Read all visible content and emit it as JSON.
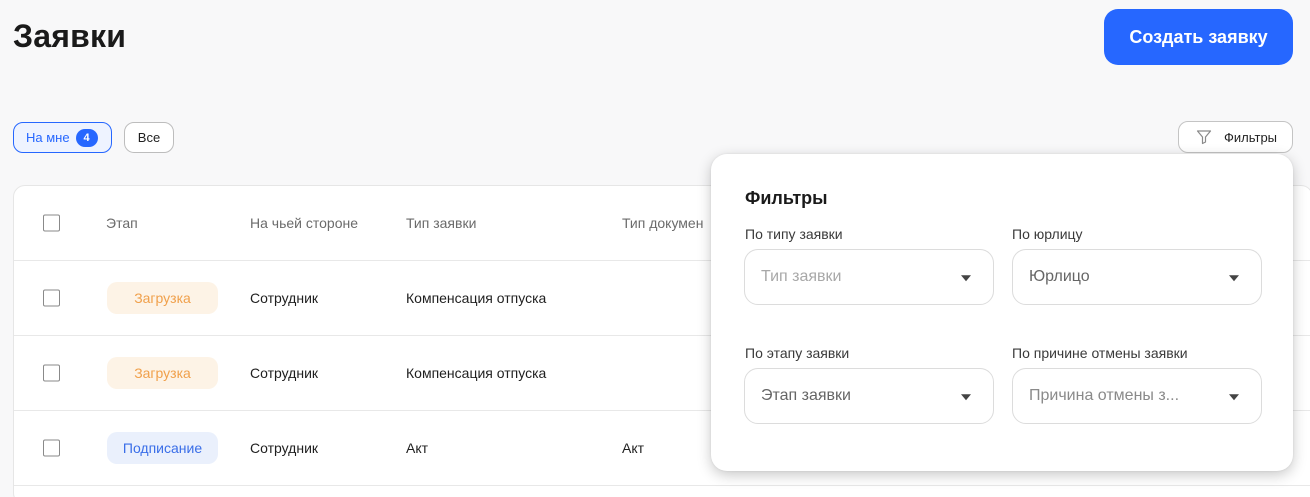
{
  "header": {
    "title": "Заявки",
    "create_label": "Создать заявку"
  },
  "tabs": {
    "mine_label": "На мне",
    "mine_count": "4",
    "all_label": "Все"
  },
  "filters_button": {
    "label": "Фильтры",
    "icon": "funnel-icon"
  },
  "table": {
    "columns": [
      "Этап",
      "На чьей стороне",
      "Тип заявки",
      "Тип докумен"
    ],
    "rows": [
      {
        "stage": "Загрузка",
        "stage_color": "#f0a04b",
        "side": "Сотрудник",
        "type": "Компенсация отпуска",
        "doc_type": ""
      },
      {
        "stage": "Загрузка",
        "stage_color": "#f0a04b",
        "side": "Сотрудник",
        "type": "Компенсация отпуска",
        "doc_type": ""
      },
      {
        "stage": "Подписание",
        "stage_color": "#3a6ee8",
        "side": "Сотрудник",
        "type": "Акт",
        "doc_type": "Акт"
      }
    ]
  },
  "filters_panel": {
    "title": "Фильтры",
    "fields": [
      {
        "label": "По типу заявки",
        "placeholder": "Тип заявки"
      },
      {
        "label": "По юрлицу",
        "placeholder": "Юрлицо"
      },
      {
        "label": "По этапу заявки",
        "placeholder": "Этап заявки"
      },
      {
        "label": "По причине отмены заявки",
        "placeholder": "Причина отмены з..."
      }
    ]
  },
  "colors": {
    "accent": "#2667ff",
    "stage_load": "#f0a04b",
    "stage_sign": "#3a6ee8"
  }
}
